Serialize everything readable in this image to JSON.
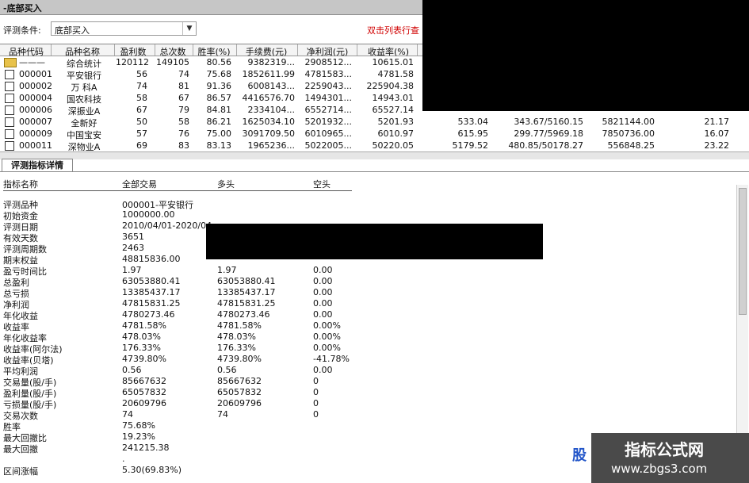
{
  "window": {
    "title": "-底部买入"
  },
  "condition": {
    "label": "评测条件:",
    "value": "底部买入",
    "hint": "双击列表行查"
  },
  "table": {
    "headers": [
      "品种代码",
      "品种名称",
      "盈利数",
      "总次数",
      "胜率(%)",
      "手续费(元)",
      "净利润(元)",
      "收益率(%)"
    ],
    "rows": [
      {
        "code": "———",
        "name": "综合统计",
        "c": [
          "120112",
          "149105",
          "80.56",
          "9382319...",
          "2908512...",
          "10615.01"
        ],
        "x": [
          "",
          "",
          "",
          ""
        ]
      },
      {
        "code": "000001",
        "name": "平安银行",
        "c": [
          "56",
          "74",
          "75.68",
          "1852611.99",
          "4781583...",
          "4781.58"
        ],
        "x": [
          "",
          "",
          "",
          ""
        ]
      },
      {
        "code": "000002",
        "name": "万 科A",
        "c": [
          "74",
          "81",
          "91.36",
          "6008143...",
          "2259043...",
          "225904.38"
        ],
        "x": [
          "",
          "",
          "",
          ""
        ]
      },
      {
        "code": "000004",
        "name": "国农科技",
        "c": [
          "58",
          "67",
          "86.57",
          "4416576.70",
          "1494301...",
          "14943.01"
        ],
        "x": [
          "",
          "",
          "",
          ""
        ]
      },
      {
        "code": "000006",
        "name": "深振业A",
        "c": [
          "67",
          "79",
          "84.81",
          "2334104...",
          "6552714...",
          "65527.14"
        ],
        "x": [
          "",
          "",
          "",
          ""
        ]
      },
      {
        "code": "000007",
        "name": "全新好",
        "c": [
          "50",
          "58",
          "86.21",
          "1625034.10",
          "5201932...",
          "5201.93"
        ],
        "x": [
          "533.04",
          "343.67/5160.15",
          "5821144.00",
          "21.17"
        ]
      },
      {
        "code": "000009",
        "name": "中国宝安",
        "c": [
          "57",
          "76",
          "75.00",
          "3091709.50",
          "6010965...",
          "6010.97"
        ],
        "x": [
          "615.95",
          "299.77/5969.18",
          "7850736.00",
          "16.07"
        ]
      },
      {
        "code": "000011",
        "name": "深物业A",
        "c": [
          "69",
          "83",
          "83.13",
          "1965236...",
          "5022005...",
          "50220.05"
        ],
        "x": [
          "5179.52",
          "480.85/50178.27",
          "556848.25",
          "23.22"
        ]
      }
    ]
  },
  "detail_tab": {
    "label": "评测指标详情"
  },
  "detail": {
    "headers": [
      "指标名称",
      "全部交易",
      "多头",
      "空头"
    ],
    "rows": [
      [
        "评测品种",
        "000001-平安银行",
        "",
        ""
      ],
      [
        "初始资金",
        "1000000.00",
        "",
        ""
      ],
      [
        "评测日期",
        "2010/04/01-2020/04",
        "",
        ""
      ],
      [
        "有效天数",
        "3651",
        "",
        ""
      ],
      [
        "评测周期数",
        "2463",
        "",
        ""
      ],
      [
        "期末权益",
        "48815836.00",
        "",
        ""
      ],
      [
        "盈亏时间比",
        "1.97",
        "1.97",
        "0.00"
      ],
      [
        "总盈利",
        "63053880.41",
        "63053880.41",
        "0.00"
      ],
      [
        "总亏损",
        "13385437.17",
        "13385437.17",
        "0.00"
      ],
      [
        "净利润",
        "47815831.25",
        "47815831.25",
        "0.00"
      ],
      [
        "年化收益",
        "4780273.46",
        "4780273.46",
        "0.00"
      ],
      [
        "收益率",
        "4781.58%",
        "4781.58%",
        "0.00%"
      ],
      [
        "年化收益率",
        "478.03%",
        "478.03%",
        "0.00%"
      ],
      [
        "收益率(阿尔法)",
        "176.33%",
        "176.33%",
        "0.00%"
      ],
      [
        "收益率(贝塔)",
        "4739.80%",
        "4739.80%",
        "-41.78%"
      ],
      [
        "平均利润",
        "0.56",
        "0.56",
        "0.00"
      ],
      [
        "交易量(股/手)",
        "85667632",
        "85667632",
        "0"
      ],
      [
        "盈利量(股/手)",
        "65057832",
        "65057832",
        "0"
      ],
      [
        "亏损量(股/手)",
        "20609796",
        "20609796",
        "0"
      ],
      [
        "交易次数",
        "74",
        "74",
        "0"
      ],
      [
        "胜率",
        "75.68%",
        "",
        ""
      ],
      [
        "最大回撤比",
        "19.23%",
        "",
        ""
      ],
      [
        "最大回撤",
        "241215.38",
        "",
        ""
      ],
      [
        "",
        ".",
        "",
        ""
      ],
      [
        "区间涨幅",
        "5.30(69.83%)",
        "",
        ""
      ]
    ]
  },
  "watermark": {
    "line1": "指标公式网",
    "line2": "www.zbgs3.com",
    "sliver": "股"
  }
}
